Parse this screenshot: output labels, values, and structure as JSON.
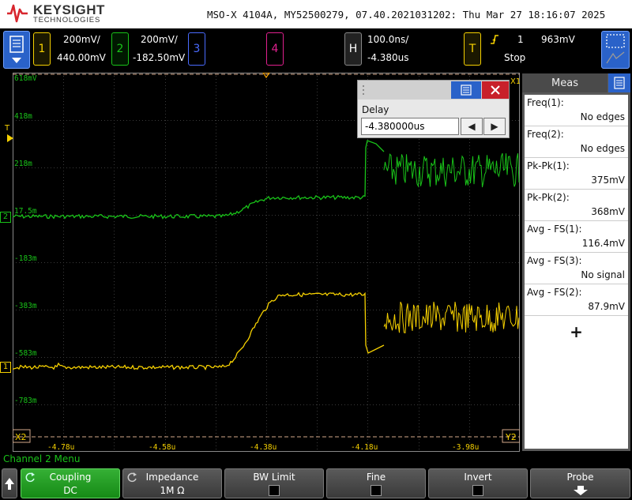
{
  "header": {
    "brand": "KEYSIGHT",
    "brand_sub": "TECHNOLOGIES",
    "title": "MSO-X 4104A, MY52500279, 07.40.2021031202: Thu Mar 27 18:16:07 2025"
  },
  "channels": {
    "ch1": {
      "num": "1",
      "scale": "200mV/",
      "offset": "440.00mV",
      "color": "#f5d000"
    },
    "ch2": {
      "num": "2",
      "scale": "200mV/",
      "offset": "-182.50mV",
      "color": "#19c319"
    },
    "ch3": {
      "num": "3",
      "color": "#4a6bff"
    },
    "ch4": {
      "num": "4",
      "color": "#e0208e"
    }
  },
  "horizontal": {
    "label": "H",
    "scale": "100.0ns/",
    "delay": "-4.380us"
  },
  "trigger": {
    "label": "T",
    "source": "1",
    "level": "963mV",
    "status": "Stop",
    "slope_icon": "rising-edge-icon"
  },
  "grid": {
    "y_labels": [
      "618mV",
      "418m",
      "218m",
      "17.5m",
      "-183m",
      "-383m",
      "-583m",
      "-783m"
    ],
    "x_labels": [
      "-4.78u",
      "-4.58u",
      "-4.38u",
      "-4.18u",
      "-3.98u"
    ],
    "marker_x2": "X2",
    "marker_y2": "Y2",
    "marker_x1": "X1",
    "ground_ch2": "2",
    "ground_ch1": "1",
    "trig_marker": "T"
  },
  "delay_dialog": {
    "label": "Delay",
    "value": "-4.380000us",
    "left_arrow": "◀",
    "right_arrow": "▶"
  },
  "meas": {
    "title": "Meas",
    "items": [
      {
        "name": "Freq(1):",
        "value": "No edges"
      },
      {
        "name": "Freq(2):",
        "value": "No edges"
      },
      {
        "name": "Pk-Pk(1):",
        "value": "375mV"
      },
      {
        "name": "Pk-Pk(2):",
        "value": "368mV"
      },
      {
        "name": "Avg - FS(1):",
        "value": "116.4mV"
      },
      {
        "name": "Avg - FS(3):",
        "value": "No signal"
      },
      {
        "name": "Avg - FS(2):",
        "value": "87.9mV"
      }
    ],
    "add": "+"
  },
  "bottom": {
    "menu_title": "Channel 2 Menu",
    "softkeys": [
      {
        "label": "Coupling",
        "value": "DC"
      },
      {
        "label": "Impedance",
        "value": "1M Ω"
      },
      {
        "label": "BW Limit"
      },
      {
        "label": "Fine"
      },
      {
        "label": "Invert"
      },
      {
        "label": "Probe"
      }
    ]
  }
}
